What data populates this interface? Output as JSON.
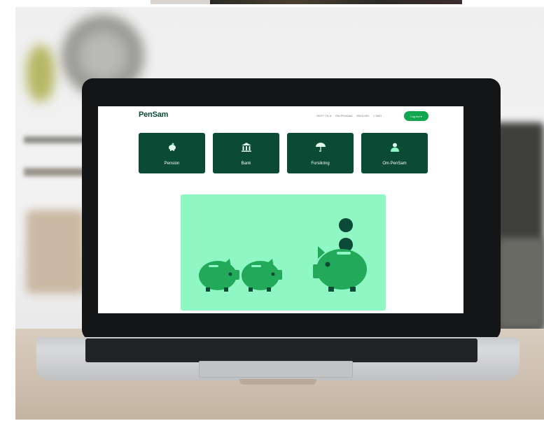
{
  "site": {
    "logo": "PenSam",
    "nav": [
      "SKIFT TIL ▾",
      "OM PENSAM",
      "ENGLISH",
      "⌕ SØG"
    ],
    "login_label": "Log ind ▾",
    "tiles": [
      {
        "label": "Pension",
        "icon": "piggy-bank-icon"
      },
      {
        "label": "Bank",
        "icon": "bank-building-icon"
      },
      {
        "label": "Forsikring",
        "icon": "umbrella-icon"
      },
      {
        "label": "Om PenSam",
        "icon": "person-icon"
      }
    ],
    "hero": {
      "illustration": "three-piggy-banks-with-coins",
      "background_color": "#8ef7c4",
      "pig_color": "#22a95a"
    },
    "colors": {
      "brand_dark": "#0b4a34",
      "brand_green": "#12a64e"
    }
  }
}
